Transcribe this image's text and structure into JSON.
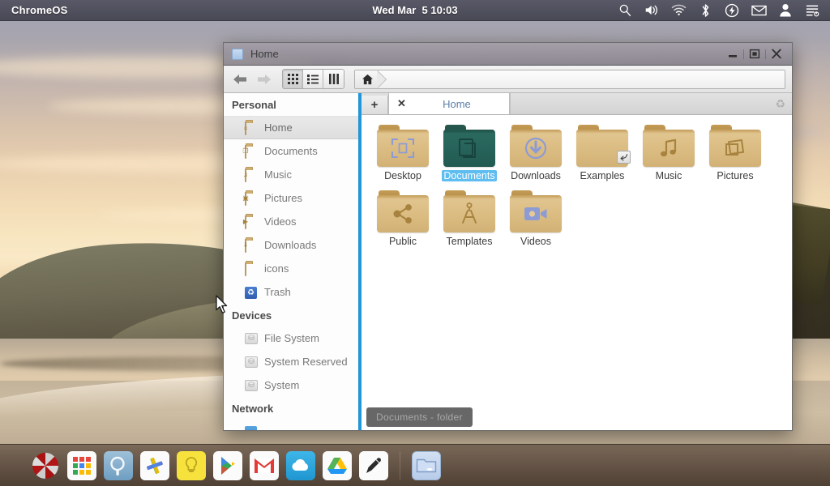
{
  "top_panel": {
    "title": "ChromeOS",
    "clock": "Wed Mar  5 10:03",
    "tray": [
      {
        "name": "search-icon",
        "label": "Search"
      },
      {
        "name": "volume-icon",
        "label": "Volume"
      },
      {
        "name": "wifi-icon",
        "label": "Network"
      },
      {
        "name": "bluetooth-icon",
        "label": "Bluetooth"
      },
      {
        "name": "battery-icon",
        "label": "Power"
      },
      {
        "name": "mail-icon",
        "label": "Mail"
      },
      {
        "name": "user-icon",
        "label": "User"
      },
      {
        "name": "menu-power-icon",
        "label": "System menu"
      }
    ]
  },
  "window": {
    "title": "Home",
    "controls": {
      "minimize": "–",
      "maximize": "▣",
      "close": "✕"
    },
    "toolbar": {
      "back": "←",
      "forward": "→",
      "views": [
        {
          "name": "view-icons-button",
          "label": "Icon view",
          "active": true
        },
        {
          "name": "view-list-button",
          "label": "List view",
          "active": false
        },
        {
          "name": "view-columns-button",
          "label": "Column view",
          "active": false
        }
      ],
      "path_crumb": "Home",
      "location_value": ""
    },
    "tabbar": {
      "new_tab": "+",
      "close_tab": "✕",
      "tab_label": "Home",
      "recycle": "♻"
    },
    "sidebar": {
      "sections": [
        {
          "title": "Personal",
          "items": [
            {
              "label": "Home",
              "icon": "folder-home-icon",
              "selected": true,
              "glyph": "⌂"
            },
            {
              "label": "Documents",
              "icon": "folder-documents-icon",
              "selected": false,
              "glyph": "❐"
            },
            {
              "label": "Music",
              "icon": "folder-music-icon",
              "selected": false,
              "glyph": "♫"
            },
            {
              "label": "Pictures",
              "icon": "folder-pictures-icon",
              "selected": false,
              "glyph": "▣"
            },
            {
              "label": "Videos",
              "icon": "folder-videos-icon",
              "selected": false,
              "glyph": "▶"
            },
            {
              "label": "Downloads",
              "icon": "folder-downloads-icon",
              "selected": false,
              "glyph": "⬇"
            },
            {
              "label": "icons",
              "icon": "folder-plain-icon",
              "selected": false,
              "glyph": ""
            },
            {
              "label": "Trash",
              "icon": "trash-icon",
              "selected": false,
              "glyph": "♻"
            }
          ]
        },
        {
          "title": "Devices",
          "items": [
            {
              "label": "File System",
              "icon": "drive-icon",
              "selected": false,
              "glyph": "⛁"
            },
            {
              "label": "System Reserved",
              "icon": "drive-icon",
              "selected": false,
              "glyph": "⛁"
            },
            {
              "label": "System",
              "icon": "drive-icon",
              "selected": false,
              "glyph": "⛁"
            }
          ]
        },
        {
          "title": "Network",
          "items": []
        }
      ]
    },
    "files": [
      {
        "label": "Desktop",
        "glyph": "desktop",
        "selected": false,
        "is_link": false
      },
      {
        "label": "Documents",
        "glyph": "documents",
        "selected": true,
        "is_link": false
      },
      {
        "label": "Downloads",
        "glyph": "downloads",
        "selected": false,
        "is_link": false
      },
      {
        "label": "Examples",
        "glyph": "plain",
        "selected": false,
        "is_link": true
      },
      {
        "label": "Music",
        "glyph": "music",
        "selected": false,
        "is_link": false
      },
      {
        "label": "Pictures",
        "glyph": "pictures",
        "selected": false,
        "is_link": false
      },
      {
        "label": "Public",
        "glyph": "share",
        "selected": false,
        "is_link": false
      },
      {
        "label": "Templates",
        "glyph": "templates",
        "selected": false,
        "is_link": false
      },
      {
        "label": "Videos",
        "glyph": "videos",
        "selected": false,
        "is_link": false
      }
    ],
    "status_tip": "Documents - folder"
  },
  "dock": {
    "items": [
      {
        "name": "umbrella-corp-icon",
        "label": "Umbrella"
      },
      {
        "name": "app-grid-icon",
        "label": "Apps"
      },
      {
        "name": "search-app-icon",
        "label": "Search"
      },
      {
        "name": "slack-icon",
        "label": "Slack"
      },
      {
        "name": "notes-icon",
        "label": "Keep Notes"
      },
      {
        "name": "play-store-icon",
        "label": "Play Store"
      },
      {
        "name": "gmail-icon",
        "label": "Gmail"
      },
      {
        "name": "cloud-icon",
        "label": "Cloud"
      },
      {
        "name": "google-drive-icon",
        "label": "Drive"
      },
      {
        "name": "pencil-icon",
        "label": "Editor"
      },
      {
        "name": "file-manager-icon",
        "label": "Files"
      }
    ]
  },
  "colors": {
    "accent_blue": "#2196d9",
    "selection_blue": "#5fbdf0",
    "folder_tan": "#dcbe84",
    "folder_selected_teal": "#27635a",
    "panel_dark": "#3a3a46"
  }
}
